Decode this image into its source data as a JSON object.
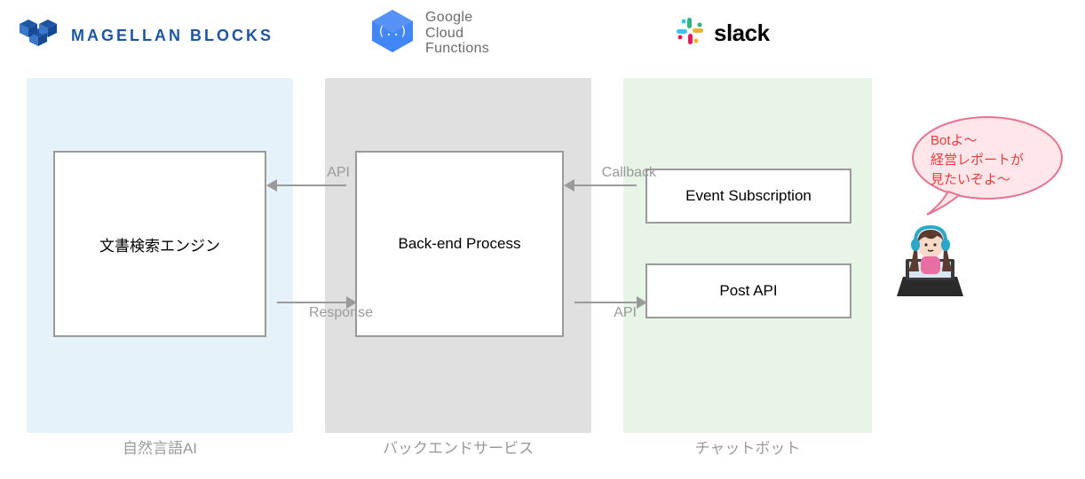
{
  "logos": {
    "magellan": {
      "text": "MAGELLAN BLOCKS",
      "icon": "magellan-cubes-icon"
    },
    "gcf": {
      "line1": "Google",
      "line2": "Cloud",
      "line3": "Functions",
      "icon": "gcf-icon"
    },
    "slack": {
      "text": "slack",
      "icon": "slack-icon"
    }
  },
  "columns": {
    "c1": {
      "label": "自然言語AI",
      "bg": "#e6f2fa"
    },
    "c2": {
      "label": "バックエンドサービス",
      "bg": "#e0e0e0"
    },
    "c3": {
      "label": "チャットボット",
      "bg": "#e6f5e5"
    }
  },
  "boxes": {
    "search": "文書検索エンジン",
    "backend": "Back-end Process",
    "evsub": "Event Subscription",
    "post": "Post API"
  },
  "arrows": {
    "api1": "API",
    "response": "Response",
    "callback": "Callback",
    "api2": "API"
  },
  "speech": {
    "l1": "Botよ〜",
    "l2": "経営レポートが",
    "l3": "見たいぞよ〜"
  },
  "colors": {
    "magellan_blue": "#1e56a5",
    "gcf_blue": "#4285f4",
    "border_gray": "#9a9a9a",
    "text_gray": "#9a9a9a",
    "speech_red": "#e53b3b",
    "speech_fill": "#ffe6eb",
    "speech_stroke": "#e5738f"
  }
}
